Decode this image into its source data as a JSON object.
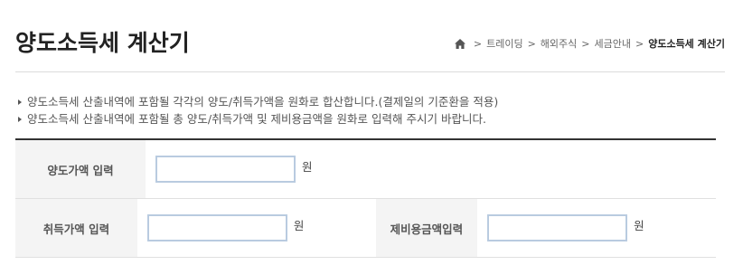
{
  "header": {
    "title": "양도소득세 계산기"
  },
  "breadcrumb": {
    "items": [
      "트레이딩",
      "해외주식",
      "세금안내"
    ],
    "current": "양도소득세 계산기",
    "separator": ">"
  },
  "notes": [
    "양도소득세 산출내역에 포함될 각각의 양도/취득가액을 원화로 합산합니다.(결제일의 기준환을 적용)",
    "양도소득세 산출내역에 포함될 총 양도/취득가액 및 제비용금액을 원화로 입력해 주시기 바랍니다."
  ],
  "form": {
    "transfer_price_label": "양도가액 입력",
    "transfer_price_value": "",
    "transfer_price_unit": "원",
    "acquisition_price_label": "취득가액 입력",
    "acquisition_price_value": "",
    "acquisition_price_unit": "원",
    "expense_label": "제비용금액입력",
    "expense_value": "",
    "expense_unit": "원"
  },
  "colors": {
    "input_border": "#b9cbe0",
    "label_bg": "#f4f4f4",
    "table_top_border": "#333333"
  }
}
